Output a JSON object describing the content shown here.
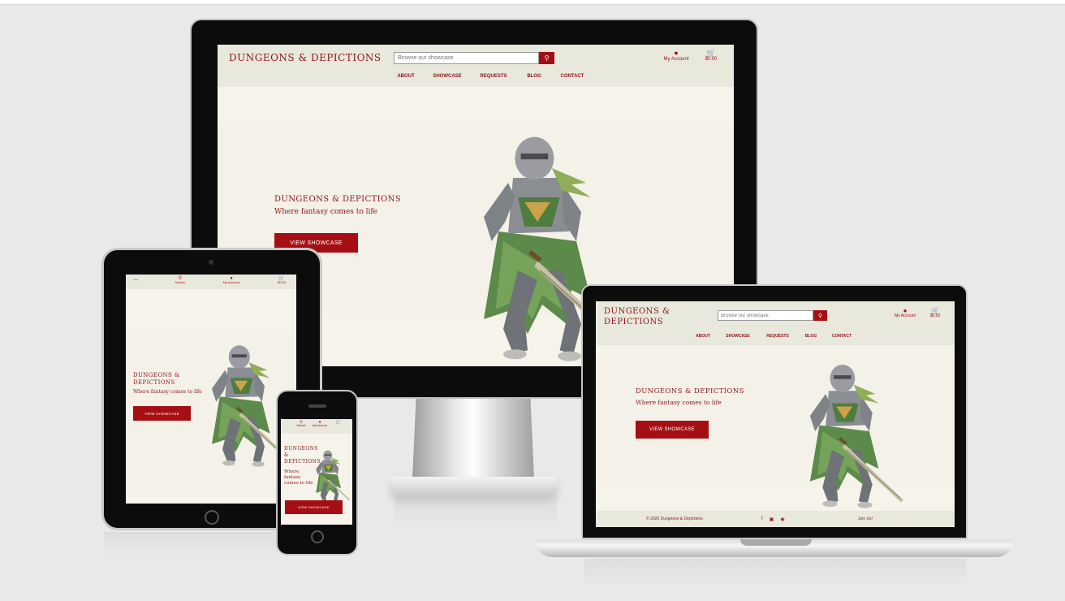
{
  "brand": {
    "name": "DUNGEONS & DEPICTIONS",
    "name_line1": "DUNGEONS &",
    "name_line2": "DEPICTIONS",
    "phone_l1": "DUNGEONS",
    "phone_l2": "&",
    "phone_l3": "DEPICTIONS"
  },
  "search": {
    "placeholder": "Browse our showcase",
    "short_label": "Search"
  },
  "account": {
    "label": "My Account"
  },
  "cart": {
    "total": "$0.00"
  },
  "nav": {
    "items": [
      "ABOUT",
      "SHOWCASE",
      "REQUESTS",
      "BLOG",
      "CONTACT"
    ]
  },
  "hero": {
    "title": "DUNGEONS & DEPICTIONS",
    "tagline": "Where fantasy comes to life",
    "tag_l1": "Where",
    "tag_l2": "fantasy",
    "tag_l3": "comes to life",
    "cta": "VIEW SHOWCASE"
  },
  "footer": {
    "copyright": "© 2020 Dungeons & Depictions",
    "link": "Join Us!"
  },
  "colors": {
    "accent": "#a50f14",
    "brand_text": "#8c1515",
    "header_bg": "#e9e8dc",
    "page_bg": "#f6f3ea"
  },
  "icons": {
    "search": "search-icon",
    "account": "user-icon",
    "cart": "cart-icon",
    "menu": "hamburger-icon"
  }
}
